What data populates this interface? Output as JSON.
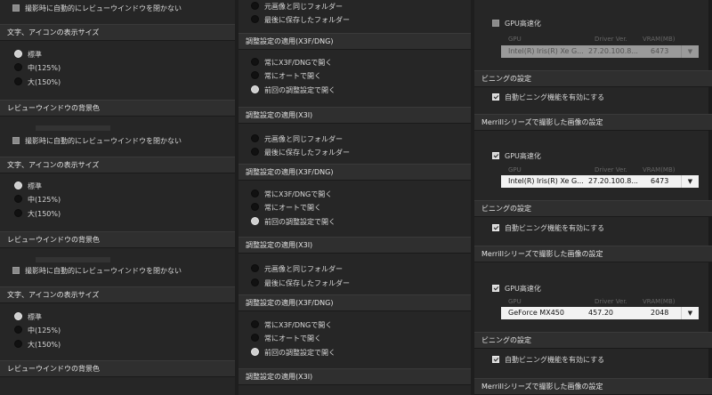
{
  "col1": {
    "close_review_on_shoot": "撮影時に自動的にレビューウインドウを閉かない",
    "text_icon_size": "文字、アイコンの表示サイズ",
    "size_standard": "標準",
    "size_medium": "中(125%)",
    "size_large": "大(150%)",
    "review_bg": "レビューウインドウの背景色"
  },
  "col2": {
    "same_folder": "元画像と同じフォルダー",
    "last_saved_folder": "最後に保存したフォルダー",
    "apply_x3f_dng": "調整設定の適用(X3F/DNG)",
    "apply_x3i": "調整設定の適用(X3I)",
    "always_x3f_dng_open": "常にX3F/DNGで開く",
    "always_auto_open": "常にオートで開く",
    "last_settings_open": "前回の調整設定で開く"
  },
  "col3": {
    "gpu_accel": "GPU高速化",
    "hdr_gpu": "GPU",
    "hdr_driver": "Driver Ver.",
    "hdr_vram": "VRAM(MB)",
    "binning_settings": "ビニングの設定",
    "enable_binning": "自動ビニング機能を有効にする",
    "merrill_settings": "Merrillシリーズで撮影した画像の設定",
    "dropdown_icon": "triangle-down",
    "gpu1": {
      "name": "Intel(R) Iris(R) Xe G...",
      "driver": "27.20.100.8...",
      "vram": "6473"
    },
    "gpu2": {
      "name": "Intel(R) Iris(R) Xe G...",
      "driver": "27.20.100.8...",
      "vram": "6473"
    },
    "gpu3": {
      "name": "GeForce MX450",
      "driver": "457.20",
      "vram": "2048"
    }
  }
}
